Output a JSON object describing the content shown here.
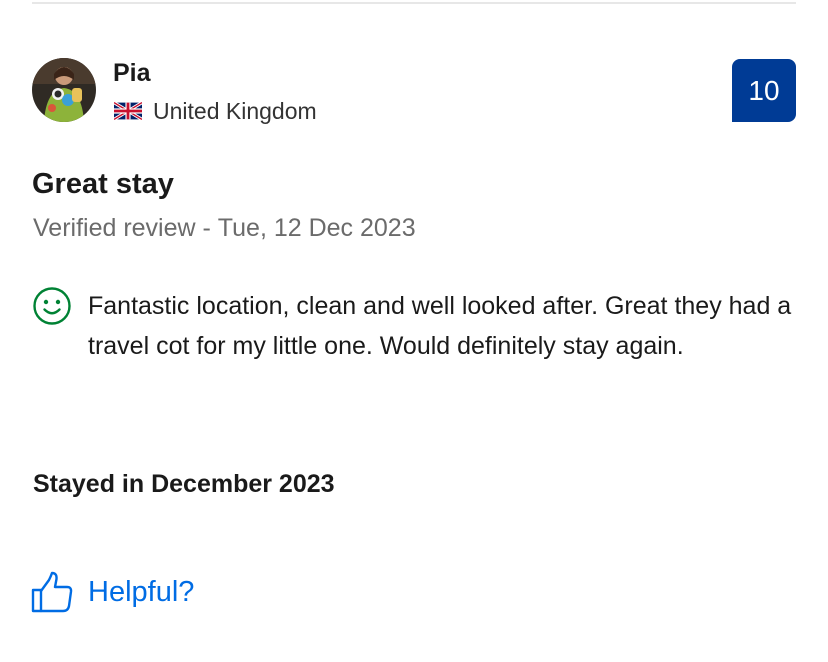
{
  "review": {
    "reviewer": {
      "name": "Pia",
      "country": "United Kingdom",
      "flag_icon": "uk-flag-icon",
      "avatar_icon": "reviewer-avatar"
    },
    "score": "10",
    "title": "Great stay",
    "meta": {
      "label": "Verified review",
      "separator": " - ",
      "date": "Tue, 12 Dec 2023"
    },
    "positive": {
      "icon": "smiley-face-icon",
      "text": "Fantastic location, clean and well looked after. Great they had a travel cot for my little one. Would definitely stay again."
    },
    "stayed": "Stayed in December 2023",
    "helpful": {
      "icon": "thumbs-up-icon",
      "label": "Helpful?"
    }
  },
  "colors": {
    "score_badge": "#003b95",
    "link": "#006ce4",
    "positive_icon": "#008234",
    "muted_text": "#6b6b6b"
  }
}
